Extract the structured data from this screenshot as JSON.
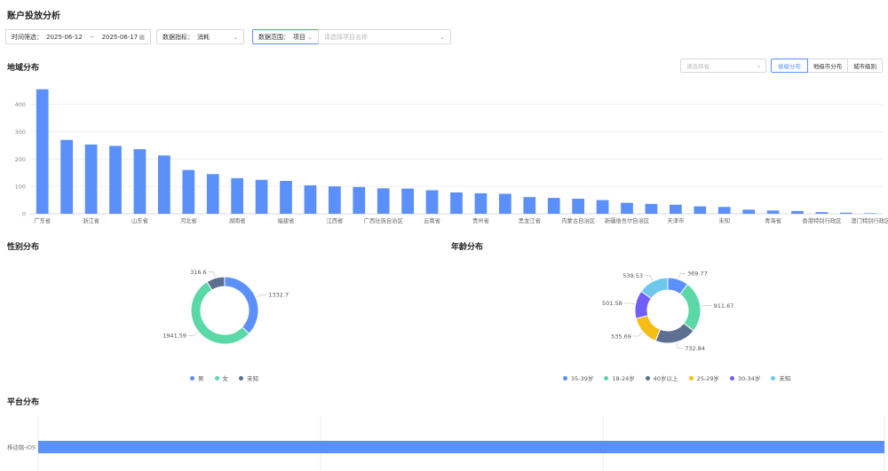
{
  "page": {
    "title": "账户投放分析"
  },
  "filters": {
    "time_label": "时间筛选：",
    "start_date": "2025-06-12",
    "date_separator": "~",
    "end_date": "2025-06-17",
    "metric_label": "数据指标：",
    "metric_value": "消耗",
    "scope_label": "数据范围：",
    "scope_value": "项目",
    "project_placeholder": "请选择项目名称"
  },
  "region": {
    "title": "地域分布",
    "select_placeholder": "请选择省",
    "tabs": [
      "省级分布",
      "地级市分布",
      "城市级别"
    ],
    "active_tab": 0
  },
  "gender": {
    "title": "性别分布"
  },
  "age": {
    "title": "年龄分布"
  },
  "platform": {
    "title": "平台分布"
  },
  "colors": {
    "blue": "#5b8ff9",
    "green": "#5ad8a6",
    "slate": "#5d7092",
    "yellow": "#f6bd16",
    "purple": "#6f5ef9",
    "cyan": "#6dc8ec"
  },
  "chart_data": [
    {
      "type": "bar",
      "name": "region",
      "categories": [
        "广东省",
        "",
        "浙江省",
        "",
        "山东省",
        "",
        "河北省",
        "",
        "湖南省",
        "",
        "福建省",
        "",
        "江西省",
        "",
        "广西壮族自治区",
        "",
        "云南省",
        "",
        "贵州省",
        "",
        "黑龙江省",
        "",
        "内蒙古自治区",
        "",
        "新疆维吾尔自治区",
        "",
        "天津市",
        "",
        "未知",
        "",
        "青海省",
        "",
        "香港特别行政区",
        "",
        "澳门特别行政区"
      ],
      "values": [
        455,
        270,
        253,
        248,
        236,
        213,
        160,
        145,
        130,
        124,
        120,
        104,
        100,
        98,
        93,
        92,
        86,
        78,
        75,
        73,
        61,
        58,
        55,
        50,
        40,
        36,
        33,
        27,
        25,
        15,
        12,
        10,
        6,
        4,
        2
      ],
      "yticks": [
        0,
        100,
        200,
        300,
        400
      ],
      "ylim": [
        0,
        470
      ],
      "grid": true
    },
    {
      "type": "pie",
      "name": "gender",
      "labels": [
        "男",
        "女",
        "未知"
      ],
      "values": [
        1332.7,
        1941.59,
        316.6
      ],
      "value_labels": [
        "1332.7",
        "1941.59",
        "316.6"
      ],
      "colors": [
        "#5b8ff9",
        "#5ad8a6",
        "#5d7092"
      ]
    },
    {
      "type": "pie",
      "name": "age",
      "labels": [
        "35-39岁",
        "18-24岁",
        "40岁以上",
        "25-29岁",
        "30-34岁",
        "未知"
      ],
      "values": [
        369.77,
        911.67,
        732.84,
        535.69,
        501.58,
        539.53
      ],
      "value_labels": [
        "369.77",
        "911.67",
        "732.84",
        "535.69",
        "501.58",
        "539.53"
      ],
      "colors": [
        "#5b8ff9",
        "#5ad8a6",
        "#5d7092",
        "#f6bd16",
        "#6f5ef9",
        "#6dc8ec"
      ]
    },
    {
      "type": "bar",
      "name": "platform",
      "orientation": "horizontal",
      "categories": [
        "移动端-iOS"
      ],
      "values": [
        1
      ],
      "grid": true
    }
  ]
}
